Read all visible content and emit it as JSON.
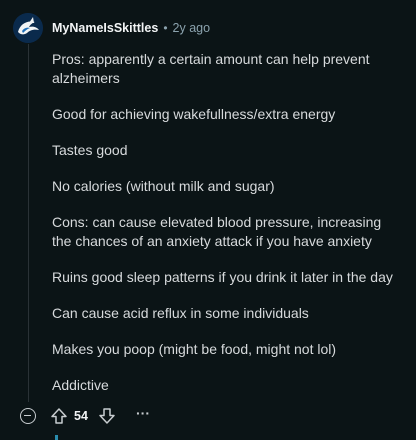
{
  "comment": {
    "username": "MyNameIsSkittles",
    "separator": "•",
    "age": "2y ago",
    "paragraphs": [
      "Pros: apparently a certain amount can help prevent alzheimers",
      "Good for achieving wakefullness/extra energy",
      "Tastes good",
      "No calories (without milk and sugar)",
      "Cons: can cause elevated blood pressure, increasing the chances of an anxiety attack if you have anxiety",
      "Ruins good sleep patterns if you drink it later in the day",
      "Can cause acid reflux in some individuals",
      "Makes you poop (might be food, might not lol)",
      "Addictive"
    ],
    "score": "54",
    "more_label": "···"
  },
  "icons": {
    "avatar": "orca-avatar-icon",
    "collapse": "collapse-minus-icon",
    "upvote": "upvote-arrow-icon",
    "downvote": "downvote-arrow-icon",
    "more": "more-options-icon"
  },
  "colors": {
    "background": "#0b1416",
    "text": "#d7dadc",
    "meta": "#8ba2ad",
    "thread_line": "#2a3236",
    "avatar_bg": "#0b2b4a",
    "accent": "#2a8cad"
  }
}
